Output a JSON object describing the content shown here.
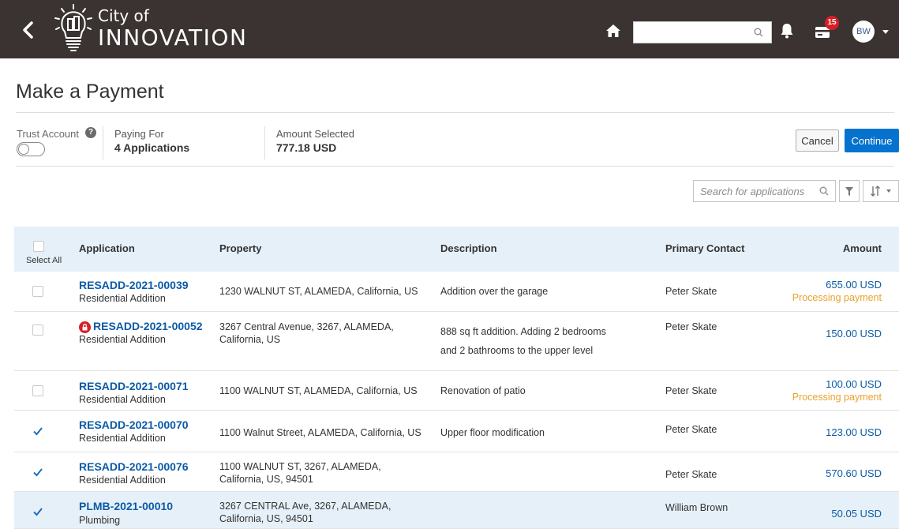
{
  "header": {
    "logo_small": "City of",
    "logo_big": "INNOVATION",
    "search_value": "",
    "cart_count": "15",
    "avatar_initials": "BW"
  },
  "page": {
    "title": "Make a Payment"
  },
  "summary": {
    "trust_account_label": "Trust Account",
    "trust_help": "?",
    "paying_for_label": "Paying For",
    "paying_for_value": "4 Applications",
    "amount_selected_label": "Amount Selected",
    "amount_selected_value": "777.18 USD",
    "cancel_label": "Cancel",
    "continue_label": "Continue"
  },
  "search": {
    "placeholder": "Search for applications"
  },
  "table": {
    "headers": {
      "select_all": "Select All",
      "application": "Application",
      "property": "Property",
      "description": "Description",
      "primary_contact": "Primary Contact",
      "amount": "Amount"
    },
    "rows": [
      {
        "checked": false,
        "locked": false,
        "app_id": "RESADD-2021-00039",
        "app_type": "Residential Addition",
        "property_1": "1230 WALNUT ST, ALAMEDA, California, US",
        "property_2": "",
        "description_1": "Addition over the garage",
        "description_2": "",
        "contact": "Peter Skate",
        "amount": "655.00 USD",
        "status": "Processing payment"
      },
      {
        "checked": false,
        "locked": true,
        "app_id": "RESADD-2021-00052",
        "app_type": "Residential Addition",
        "property_1": "3267 Central Avenue, 3267, ALAMEDA,",
        "property_2": "California, US",
        "description_1": "888 sq ft addition.  Adding 2 bedrooms",
        "description_2": "and 2 bathrooms to the upper level",
        "contact": "Peter Skate",
        "amount": "150.00 USD",
        "status": ""
      },
      {
        "checked": false,
        "locked": false,
        "app_id": "RESADD-2021-00071",
        "app_type": "Residential Addition",
        "property_1": "1100 WALNUT ST, ALAMEDA, California, US",
        "property_2": "",
        "description_1": "Renovation of patio",
        "description_2": "",
        "contact": "Peter Skate",
        "amount": "100.00 USD",
        "status": "Processing payment"
      },
      {
        "checked": true,
        "locked": false,
        "app_id": "RESADD-2021-00070",
        "app_type": "Residential Addition",
        "property_1": "1100 Walnut Street, ALAMEDA, California, US",
        "property_2": "",
        "description_1": "Upper floor modification",
        "description_2": "",
        "contact": "Peter Skate",
        "amount": "123.00 USD",
        "status": ""
      },
      {
        "checked": true,
        "locked": false,
        "app_id": "RESADD-2021-00076",
        "app_type": "Residential Addition",
        "property_1": "1100 WALNUT ST, 3267, ALAMEDA,",
        "property_2": "California, US, 94501",
        "description_1": "",
        "description_2": "",
        "contact": "Peter Skate",
        "amount": "570.60 USD",
        "status": ""
      },
      {
        "checked": true,
        "locked": false,
        "app_id": "PLMB-2021-00010",
        "app_type": "Plumbing",
        "property_1": "3267 CENTRAL Ave, 3267, ALAMEDA,",
        "property_2": "California, US, 94501",
        "description_1": "",
        "description_2": "",
        "contact": "William Brown",
        "amount": "50.05 USD",
        "status": ""
      }
    ]
  },
  "colors": {
    "header_bg": "#3a3331",
    "link_blue": "#0a5ba6",
    "primary_button": "#0572ce",
    "processing_orange": "#e8a22c",
    "table_header_bg": "#e6f0f8"
  }
}
